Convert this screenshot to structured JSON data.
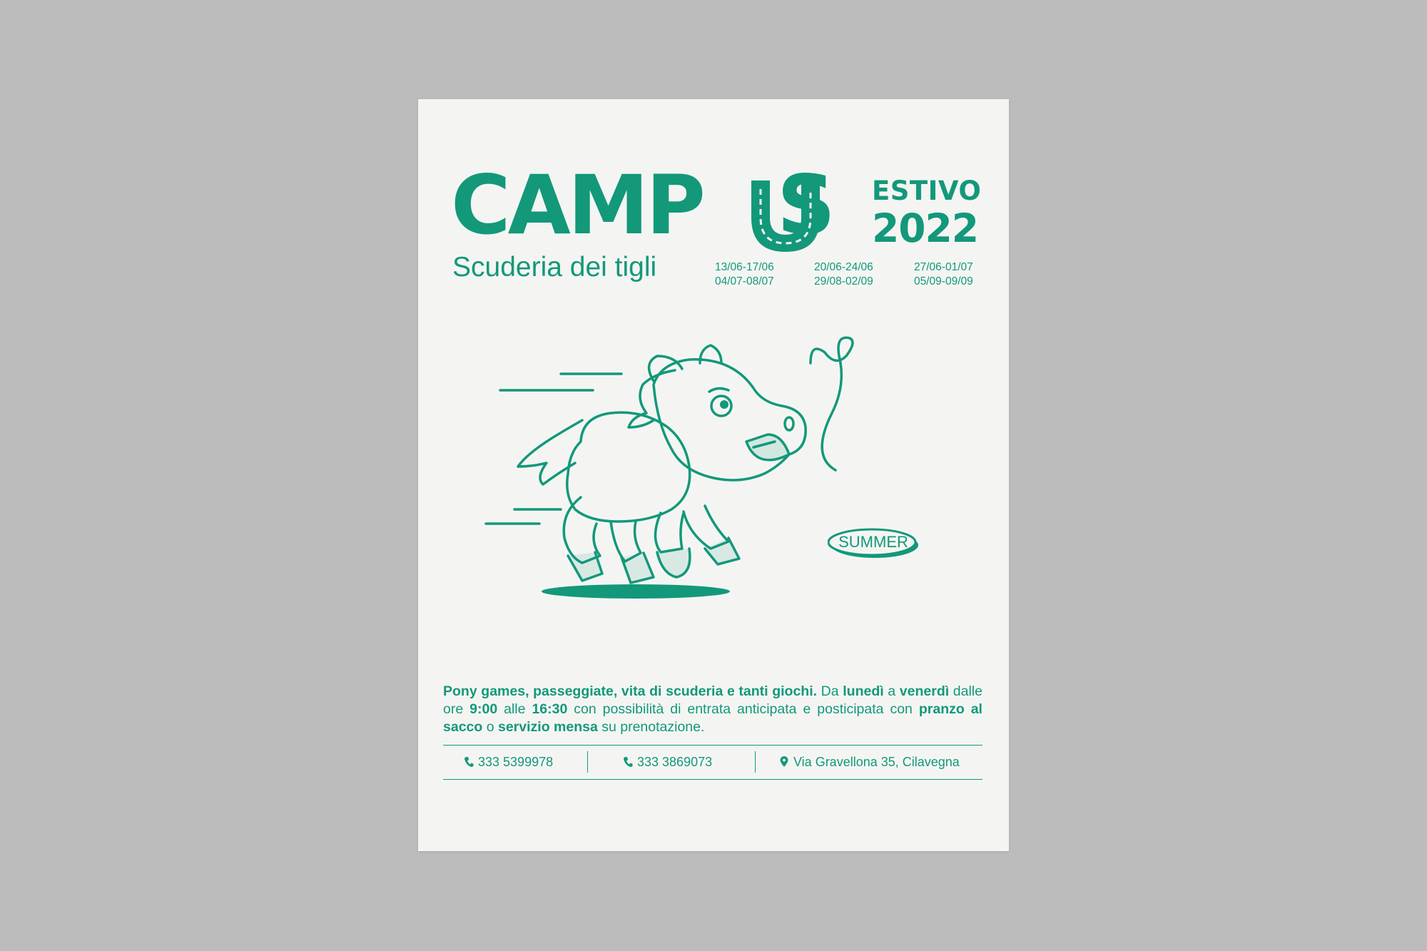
{
  "poster": {
    "title_left": "CAMP",
    "title_right": "S",
    "estivo": "ESTIVO",
    "year": "2022",
    "subtitle": "Scuderia dei tigli",
    "dates": [
      [
        "13/06-17/06",
        "04/07-08/07"
      ],
      [
        "20/06-24/06",
        "29/08-02/09"
      ],
      [
        "27/06-01/07",
        "05/09-09/09"
      ]
    ],
    "badge": "SUMMER",
    "body": {
      "p1": "Pony games, passeggiate, vita di scuderia e tanti giochi.",
      "p2": " Da ",
      "p3": "lunedì",
      "p4": " a ",
      "p5": "venerdì",
      "p6": " dalle ore ",
      "p7": "9:00",
      "p8": " alle ",
      "p9": "16:30",
      "p10": " con possibilità di entrata anticipata e posticipata con ",
      "p11": "pranzo al sacco",
      "p12": " o ",
      "p13": "servizio mensa",
      "p14": " su prenotazione."
    },
    "contacts": {
      "phone1": "333 5399978",
      "phone2": "333 3869073",
      "address": "Via Gravellona 35, Cilavegna"
    },
    "icons": [
      "horseshoe-icon",
      "phone-icon",
      "map-pin-icon"
    ],
    "colors": {
      "accent": "#13987a",
      "paper": "#f4f5f3",
      "background": "#bcbcbc"
    }
  }
}
